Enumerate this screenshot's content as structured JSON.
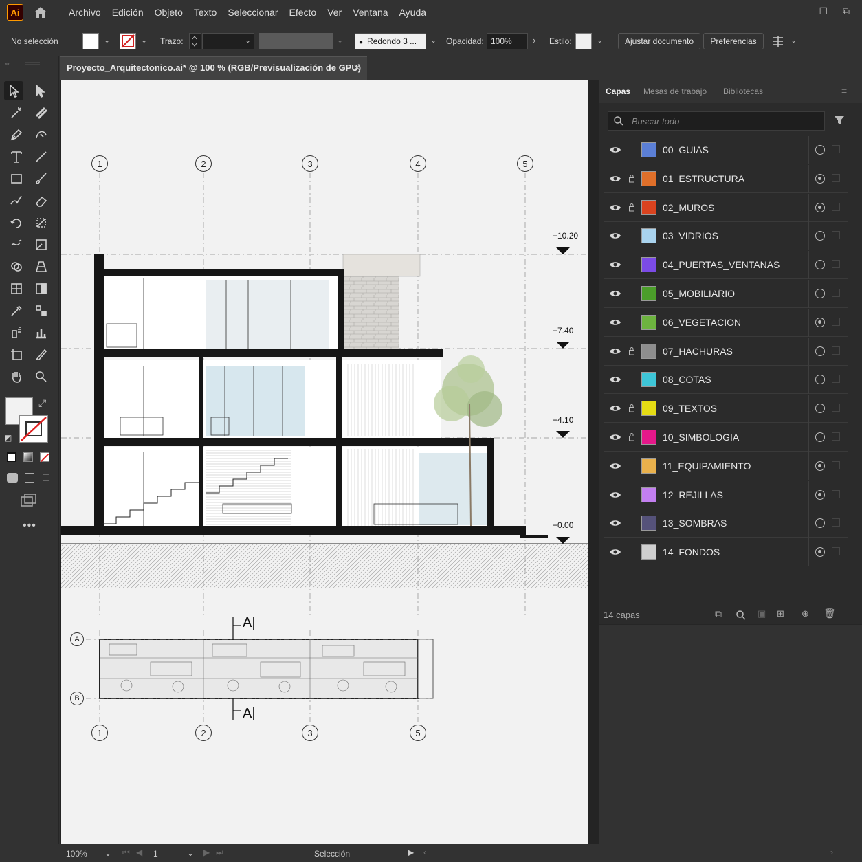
{
  "app": {
    "logo": "Ai"
  },
  "menu": [
    "Archivo",
    "Edición",
    "Objeto",
    "Texto",
    "Seleccionar",
    "Efecto",
    "Ver",
    "Ventana",
    "Ayuda"
  ],
  "window_controls": {
    "minimize": "—",
    "maximize": "☐",
    "restore": "⧉"
  },
  "control_bar": {
    "selection": "No selección",
    "stroke_label": "Trazo:",
    "brush": "Redondo 3 ...",
    "opacity_label": "Opacidad:",
    "opacity_value": "100%",
    "style_label": "Estilo:",
    "fit_document": "Ajustar documento",
    "preferences": "Preferencias"
  },
  "document_tab": {
    "title": "Proyecto_Arquitectonico.ai* @ 100 % (RGB/Previsualización de GPU)",
    "close": "✕"
  },
  "panel": {
    "tabs": [
      "Capas",
      "Mesas de trabajo",
      "Bibliotecas"
    ],
    "search_placeholder": "Buscar todo",
    "layers": [
      {
        "name": "00_GUIAS",
        "color": "#5b7fd6",
        "locked": false,
        "target_on": false
      },
      {
        "name": "01_ESTRUCTURA",
        "color": "#e0702a",
        "locked": true,
        "target_on": true
      },
      {
        "name": "02_MUROS",
        "color": "#d9431f",
        "locked": true,
        "target_on": true
      },
      {
        "name": "03_VIDRIOS",
        "color": "#a9d3ee",
        "locked": false,
        "target_on": false
      },
      {
        "name": "04_PUERTAS_VENTANAS",
        "color": "#7b4be6",
        "locked": false,
        "target_on": false
      },
      {
        "name": "05_MOBILIARIO",
        "color": "#4b9e2a",
        "locked": false,
        "target_on": false
      },
      {
        "name": "06_VEGETACION",
        "color": "#6db33f",
        "locked": false,
        "target_on": true
      },
      {
        "name": "07_HACHURAS",
        "color": "#8e8e8e",
        "locked": true,
        "target_on": false
      },
      {
        "name": "08_COTAS",
        "color": "#3ec6d8",
        "locked": false,
        "target_on": false
      },
      {
        "name": "09_TEXTOS",
        "color": "#e5dc14",
        "locked": true,
        "target_on": false
      },
      {
        "name": "10_SIMBOLOGIA",
        "color": "#e5188a",
        "locked": true,
        "target_on": false
      },
      {
        "name": "11_EQUIPAMIENTO",
        "color": "#e9b14c",
        "locked": false,
        "target_on": true
      },
      {
        "name": "12_REJILLAS",
        "color": "#c27ff0",
        "locked": false,
        "target_on": true
      },
      {
        "name": "13_SOMBRAS",
        "color": "#55527a",
        "locked": false,
        "target_on": false
      },
      {
        "name": "14_FONDOS",
        "color": "#cfcfcf",
        "locked": false,
        "target_on": true
      }
    ],
    "count": "14 capas"
  },
  "drawing": {
    "grid_top": [
      "1",
      "2",
      "3",
      "4",
      "5"
    ],
    "grid_bottom": [
      "1",
      "2",
      "3",
      "5"
    ],
    "grid_rows": [
      "A",
      "B"
    ],
    "levels": [
      "+10.20",
      "+7.40",
      "+4.10",
      "+0.00"
    ],
    "section_mark": "A|"
  },
  "status_bar": {
    "zoom": "100%",
    "artboard": "1",
    "mode": "Selección"
  },
  "icons": {
    "tools": [
      "selection-icon",
      "direct-selection-icon",
      "magic-wand-icon",
      "lasso-icon",
      "pen-icon",
      "curvature-icon",
      "type-icon",
      "line-icon",
      "rectangle-icon",
      "paintbrush-icon",
      "shaper-icon",
      "eraser-icon",
      "rotate-icon",
      "scale-icon",
      "warp-icon",
      "free-transform-icon",
      "shape-builder-icon",
      "perspective-icon",
      "mesh-icon",
      "gradient-icon",
      "eyedropper-icon",
      "blend-icon",
      "symbol-sprayer-icon",
      "column-graph-icon",
      "artboard-icon",
      "slice-icon",
      "hand-icon",
      "zoom-icon"
    ]
  }
}
